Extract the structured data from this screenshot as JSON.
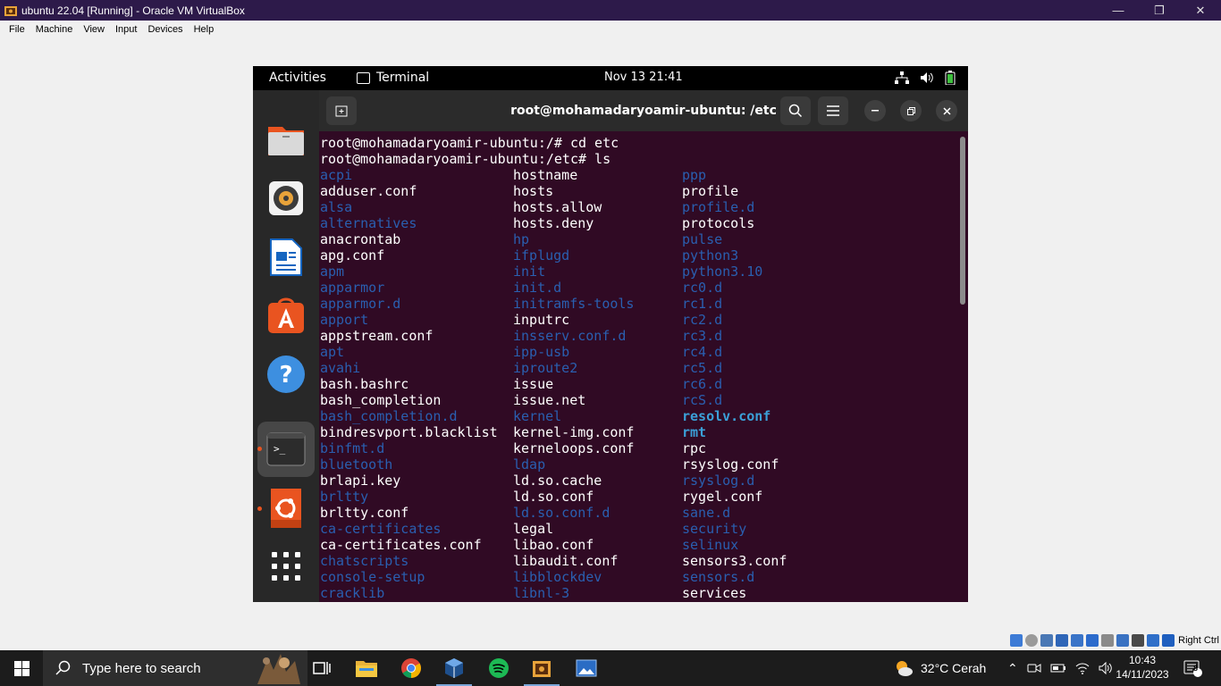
{
  "vbox": {
    "title": "ubuntu 22.04 [Running] - Oracle VM VirtualBox",
    "menu": [
      "File",
      "Machine",
      "View",
      "Input",
      "Devices",
      "Help"
    ],
    "host_key": "Right Ctrl"
  },
  "gnome": {
    "activities": "Activities",
    "app_name": "Terminal",
    "clock": "Nov 13  21:41"
  },
  "terminal": {
    "title": "root@mohamadaryoamir-ubuntu: /etc",
    "lines": [
      "root@mohamadaryoamir-ubuntu:/# cd etc",
      "root@mohamadaryoamir-ubuntu:/etc# ls"
    ],
    "columns": [
      [
        {
          "t": "acpi",
          "k": "dir"
        },
        {
          "t": "adduser.conf",
          "k": "file"
        },
        {
          "t": "alsa",
          "k": "dir"
        },
        {
          "t": "alternatives",
          "k": "dir"
        },
        {
          "t": "anacrontab",
          "k": "file"
        },
        {
          "t": "apg.conf",
          "k": "file"
        },
        {
          "t": "apm",
          "k": "dir"
        },
        {
          "t": "apparmor",
          "k": "dir"
        },
        {
          "t": "apparmor.d",
          "k": "dir"
        },
        {
          "t": "apport",
          "k": "dir"
        },
        {
          "t": "appstream.conf",
          "k": "file"
        },
        {
          "t": "apt",
          "k": "dir"
        },
        {
          "t": "avahi",
          "k": "dir"
        },
        {
          "t": "bash.bashrc",
          "k": "file"
        },
        {
          "t": "bash_completion",
          "k": "file"
        },
        {
          "t": "bash_completion.d",
          "k": "dir"
        },
        {
          "t": "bindresvport.blacklist",
          "k": "file"
        },
        {
          "t": "binfmt.d",
          "k": "dir"
        },
        {
          "t": "bluetooth",
          "k": "dir"
        },
        {
          "t": "brlapi.key",
          "k": "file"
        },
        {
          "t": "brltty",
          "k": "dir"
        },
        {
          "t": "brltty.conf",
          "k": "file"
        },
        {
          "t": "ca-certificates",
          "k": "dir"
        },
        {
          "t": "ca-certificates.conf",
          "k": "file"
        },
        {
          "t": "chatscripts",
          "k": "dir"
        },
        {
          "t": "console-setup",
          "k": "dir"
        },
        {
          "t": "cracklib",
          "k": "dir"
        }
      ],
      [
        {
          "t": "hostname",
          "k": "file"
        },
        {
          "t": "hosts",
          "k": "file"
        },
        {
          "t": "hosts.allow",
          "k": "file"
        },
        {
          "t": "hosts.deny",
          "k": "file"
        },
        {
          "t": "hp",
          "k": "dir"
        },
        {
          "t": "ifplugd",
          "k": "dir"
        },
        {
          "t": "init",
          "k": "dir"
        },
        {
          "t": "init.d",
          "k": "dir"
        },
        {
          "t": "initramfs-tools",
          "k": "dir"
        },
        {
          "t": "inputrc",
          "k": "file"
        },
        {
          "t": "insserv.conf.d",
          "k": "dir"
        },
        {
          "t": "ipp-usb",
          "k": "dir"
        },
        {
          "t": "iproute2",
          "k": "dir"
        },
        {
          "t": "issue",
          "k": "file"
        },
        {
          "t": "issue.net",
          "k": "file"
        },
        {
          "t": "kernel",
          "k": "dir"
        },
        {
          "t": "kernel-img.conf",
          "k": "file"
        },
        {
          "t": "kerneloops.conf",
          "k": "file"
        },
        {
          "t": "ldap",
          "k": "dir"
        },
        {
          "t": "ld.so.cache",
          "k": "file"
        },
        {
          "t": "ld.so.conf",
          "k": "file"
        },
        {
          "t": "ld.so.conf.d",
          "k": "dir"
        },
        {
          "t": "legal",
          "k": "file"
        },
        {
          "t": "libao.conf",
          "k": "file"
        },
        {
          "t": "libaudit.conf",
          "k": "file"
        },
        {
          "t": "libblockdev",
          "k": "dir"
        },
        {
          "t": "libnl-3",
          "k": "dir"
        }
      ],
      [
        {
          "t": "ppp",
          "k": "dir"
        },
        {
          "t": "profile",
          "k": "file"
        },
        {
          "t": "profile.d",
          "k": "dir"
        },
        {
          "t": "protocols",
          "k": "file"
        },
        {
          "t": "pulse",
          "k": "dir"
        },
        {
          "t": "python3",
          "k": "dir"
        },
        {
          "t": "python3.10",
          "k": "dir"
        },
        {
          "t": "rc0.d",
          "k": "dir"
        },
        {
          "t": "rc1.d",
          "k": "dir"
        },
        {
          "t": "rc2.d",
          "k": "dir"
        },
        {
          "t": "rc3.d",
          "k": "dir"
        },
        {
          "t": "rc4.d",
          "k": "dir"
        },
        {
          "t": "rc5.d",
          "k": "dir"
        },
        {
          "t": "rc6.d",
          "k": "dir"
        },
        {
          "t": "rcS.d",
          "k": "dir"
        },
        {
          "t": "resolv.conf",
          "k": "link"
        },
        {
          "t": "rmt",
          "k": "link"
        },
        {
          "t": "rpc",
          "k": "file"
        },
        {
          "t": "rsyslog.conf",
          "k": "file"
        },
        {
          "t": "rsyslog.d",
          "k": "dir"
        },
        {
          "t": "rygel.conf",
          "k": "file"
        },
        {
          "t": "sane.d",
          "k": "dir"
        },
        {
          "t": "security",
          "k": "dir"
        },
        {
          "t": "selinux",
          "k": "dir"
        },
        {
          "t": "sensors3.conf",
          "k": "file"
        },
        {
          "t": "sensors.d",
          "k": "dir"
        },
        {
          "t": "services",
          "k": "file"
        }
      ]
    ]
  },
  "taskbar": {
    "search_placeholder": "Type here to search",
    "weather": "32°C  Cerah",
    "time": "10:43",
    "date": "14/11/2023",
    "notifications": "8"
  },
  "colors": {
    "terminal_bg": "#300a24",
    "dir": "#2a5fb0",
    "link": "#3ba0d8",
    "accent": "#e95420"
  }
}
